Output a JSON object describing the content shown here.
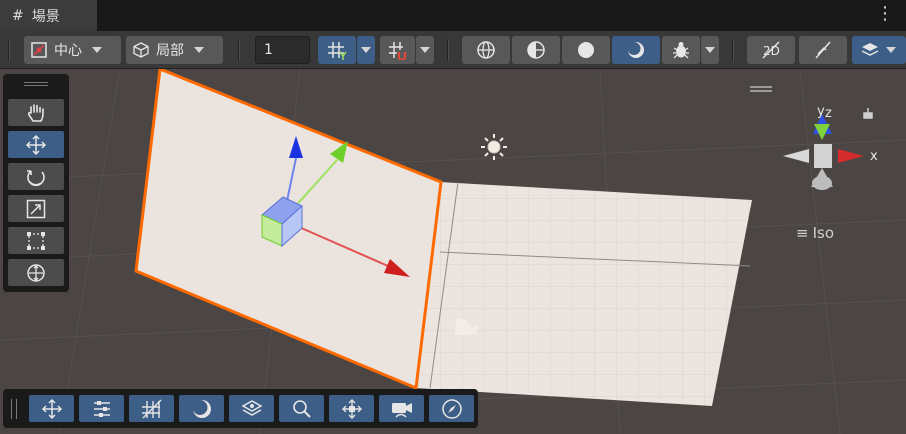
{
  "tab": {
    "icon": "#",
    "title": "場景"
  },
  "toolbar": {
    "pivot_mode": "中心",
    "pivot_rotation": "局部",
    "grid_snap_value": "1"
  },
  "gizmo": {
    "y_label": "y",
    "z_label": "z",
    "x_label": "x",
    "projection_label": "Iso"
  },
  "icons": {
    "tools": [
      "hand-icon",
      "move-icon",
      "rotate-icon",
      "scale-icon",
      "rect-icon",
      "transform-icon"
    ],
    "overlay": [
      "move-icon",
      "sliders-icon",
      "grid-icon",
      "moon-icon",
      "layers-icon",
      "zoom-icon",
      "pivot-icon",
      "camera-icon",
      "compass-icon"
    ]
  },
  "colors": {
    "accent": "#3d5e87",
    "selection_outline": "#ff6a00",
    "axis_x": "#d42c2c",
    "axis_y": "#7ed33d",
    "axis_z": "#2f50e6"
  }
}
